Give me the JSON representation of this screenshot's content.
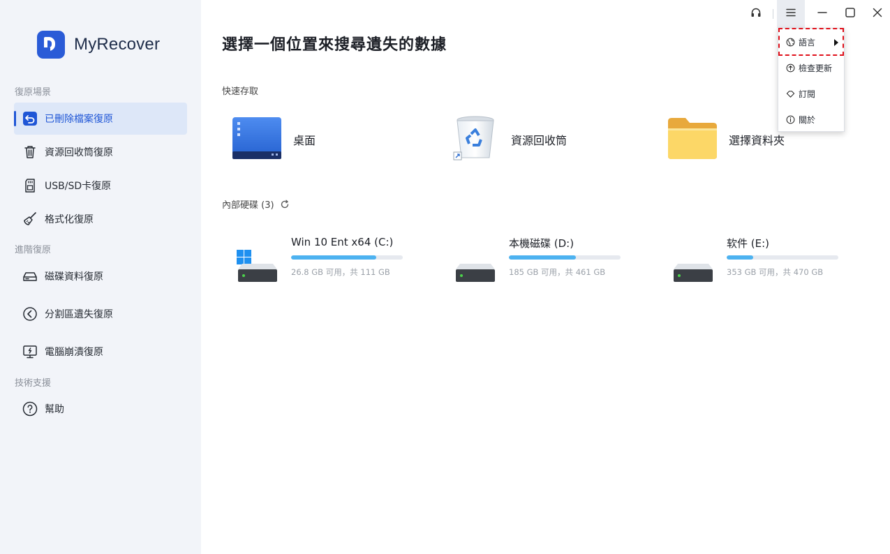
{
  "app": {
    "name": "MyRecover"
  },
  "sidebar": {
    "sections": [
      {
        "label": "復原場景"
      },
      {
        "label": "進階復原"
      },
      {
        "label": "技術支援"
      }
    ],
    "items": [
      {
        "label": "已刪除檔案復原",
        "icon": "restore-arrow-icon",
        "active": true
      },
      {
        "label": "資源回收筒復原",
        "icon": "trash-icon"
      },
      {
        "label": "USB/SD卡復原",
        "icon": "sd-card-icon"
      },
      {
        "label": "格式化復原",
        "icon": "broom-icon"
      },
      {
        "label": "磁碟資料復原",
        "icon": "disk-icon"
      },
      {
        "label": "分割區遺失復原",
        "icon": "partition-icon"
      },
      {
        "label": "電腦崩潰復原",
        "icon": "crash-monitor-icon"
      },
      {
        "label": "幫助",
        "icon": "help-icon"
      }
    ]
  },
  "main": {
    "title": "選擇一個位置來搜尋遺失的數據",
    "quick_access": {
      "label": "快速存取",
      "items": [
        {
          "label": "桌面",
          "icon": "desktop-icon"
        },
        {
          "label": "資源回收筒",
          "icon": "recycle-bin-icon"
        },
        {
          "label": "選擇資料夾",
          "icon": "folder-icon"
        }
      ]
    },
    "drives": {
      "label": "內部硬碟 (3)",
      "items": [
        {
          "name": "Win 10 Ent x64 (C:)",
          "info": "26.8 GB 可用，共 111 GB",
          "used_fraction": 0.76
        },
        {
          "name": "本機磁碟 (D:)",
          "info": "185 GB 可用，共 461 GB",
          "used_fraction": 0.6
        },
        {
          "name": "软件 (E:)",
          "info": "353 GB 可用，共 470 GB",
          "used_fraction": 0.24
        }
      ]
    }
  },
  "menu": {
    "items": [
      {
        "label": "語言",
        "icon": "globe-icon",
        "has_submenu": true
      },
      {
        "label": "檢查更新",
        "icon": "upload-circle-icon"
      },
      {
        "label": "訂閱",
        "icon": "diamond-icon"
      },
      {
        "label": "關於",
        "icon": "info-icon"
      }
    ]
  },
  "colors": {
    "accent": "#1f56d6",
    "sidebar_bg": "#f2f4f9",
    "bar_fill": "#4db2f0",
    "highlight": "#e0101a"
  }
}
